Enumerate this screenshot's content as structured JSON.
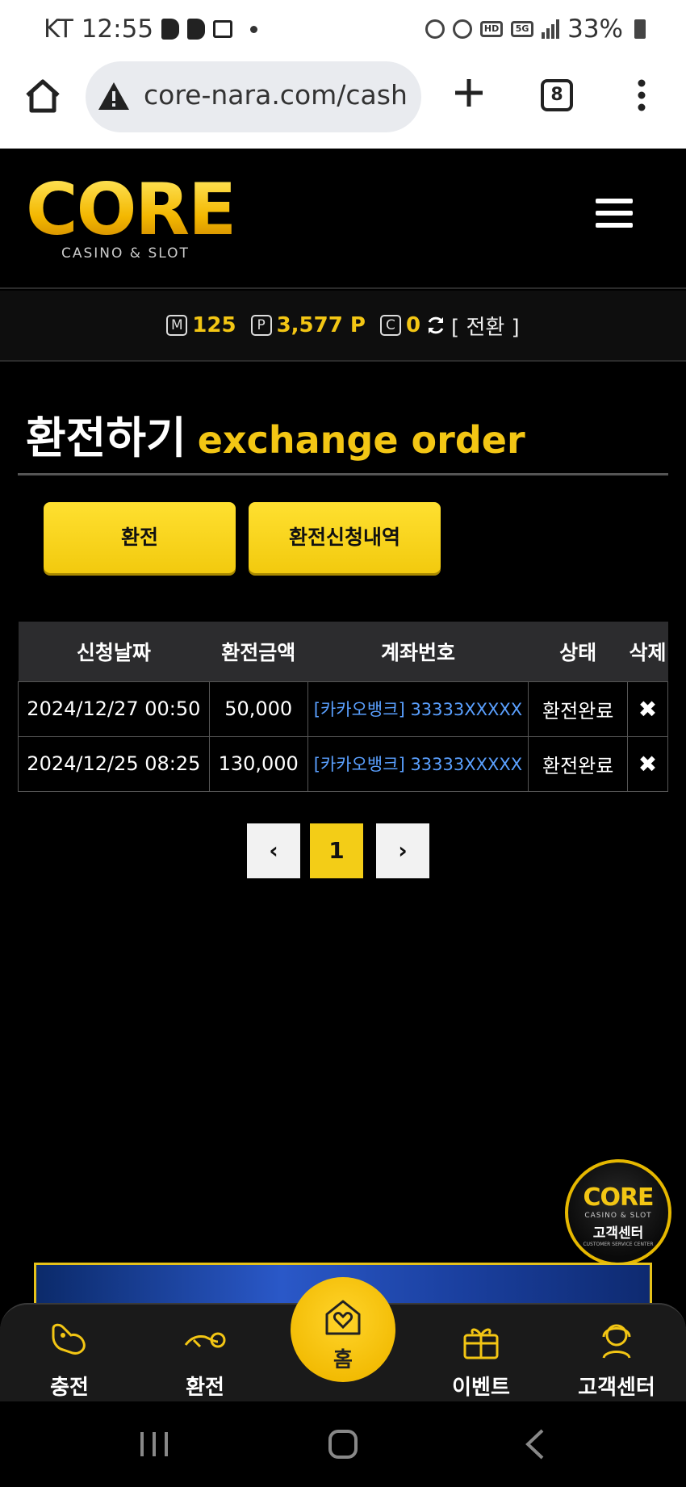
{
  "status_bar": {
    "carrier_time": "KT 12:55",
    "battery": "33%"
  },
  "browser": {
    "url": "core-nara.com/cash_",
    "tab_count": "8"
  },
  "site": {
    "logo_text": "CORE",
    "logo_sub": "CASINO & SLOT"
  },
  "balance": {
    "money_badge": "M",
    "money_value": "125",
    "point_badge": "P",
    "point_value": "3,577 P",
    "coin_badge": "C",
    "coin_value": "0",
    "switch_label": "[ 전환 ]"
  },
  "page": {
    "title_ko": "환전하기",
    "title_en": "exchange order"
  },
  "actions": {
    "exchange_label": "환전",
    "history_label": "환전신청내역"
  },
  "table": {
    "headers": [
      "신청날짜",
      "환전금액",
      "계좌번호",
      "상태",
      "삭제"
    ],
    "rows": [
      {
        "date": "2024/12/27 00:50",
        "amount": "50,000",
        "account": "[카카오뱅크] 33333XXXXX",
        "status": "환전완료",
        "delete": "✖"
      },
      {
        "date": "2024/12/25 08:25",
        "amount": "130,000",
        "account": "[카카오뱅크] 33333XXXXX",
        "status": "환전완료",
        "delete": "✖"
      }
    ]
  },
  "pagination": {
    "prev": "‹",
    "current": "1",
    "next": "›"
  },
  "cs_badge": {
    "logo": "CORE",
    "sub": "CASINO & SLOT",
    "title": "고객센터",
    "tiny": "CUSTOMER SERVICE CENTER"
  },
  "bottom_nav": {
    "charge": "충전",
    "exchange": "환전",
    "home": "홈",
    "event": "이벤트",
    "support": "고객센터"
  },
  "colors": {
    "accent": "#f3c614",
    "link": "#5aa0ff"
  }
}
